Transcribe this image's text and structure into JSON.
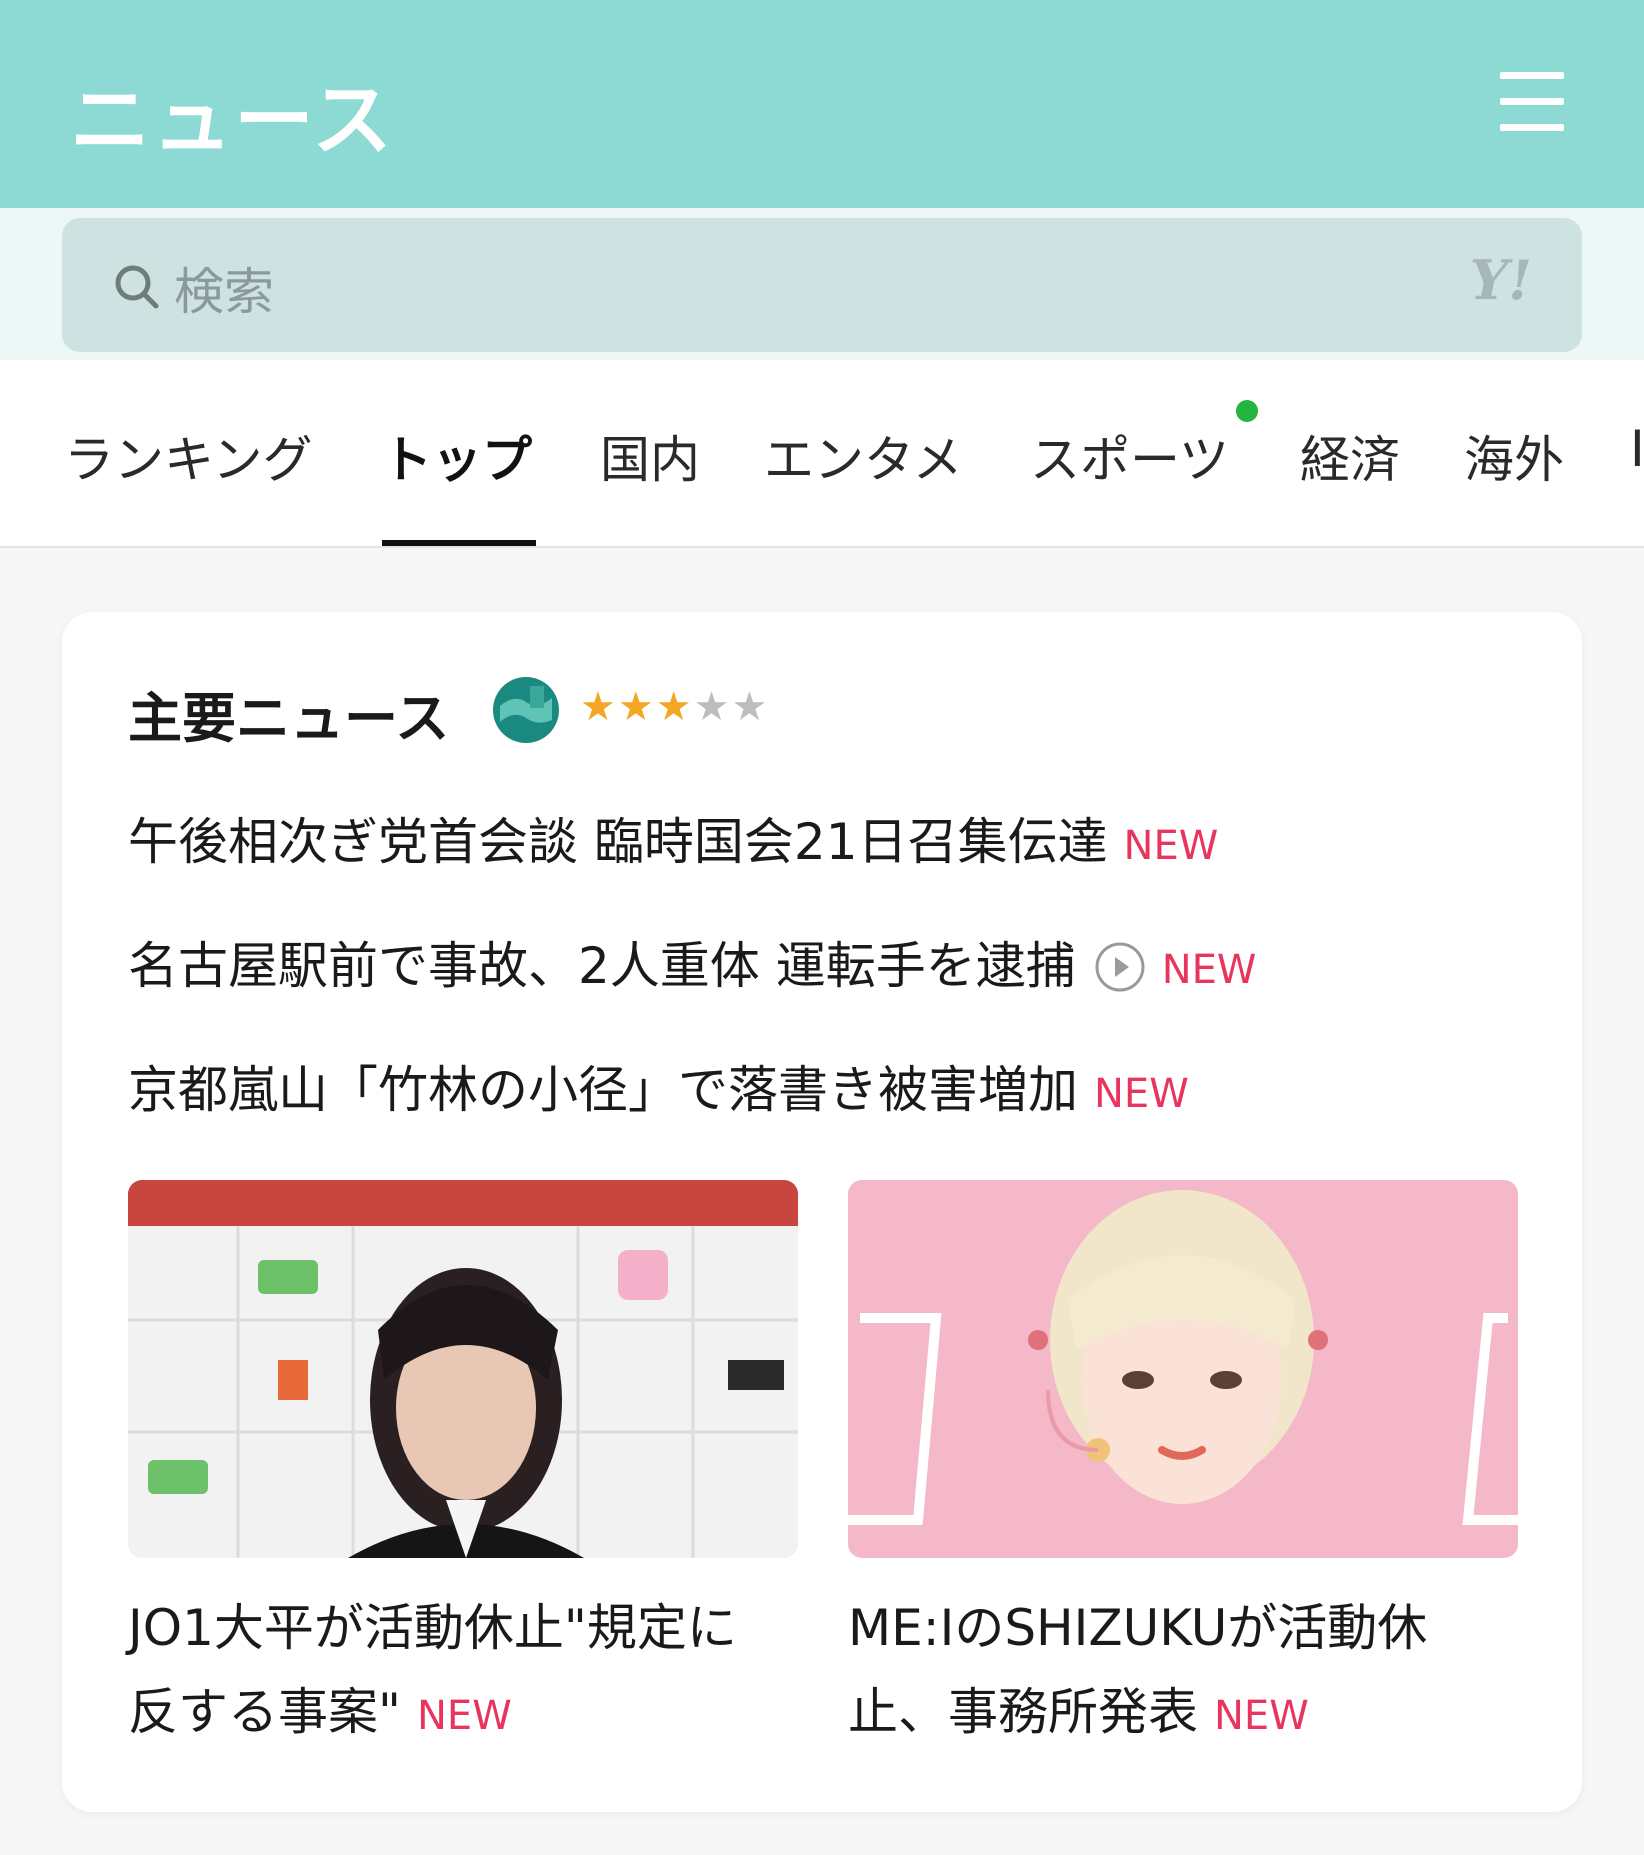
{
  "header": {
    "title": "ニュース",
    "menu_icon": "hamburger-menu-icon"
  },
  "search": {
    "placeholder": "検索",
    "brand": "Y!",
    "icon": "search-icon"
  },
  "tabs": [
    {
      "label": "ランキング",
      "active": false
    },
    {
      "label": "トップ",
      "active": true
    },
    {
      "label": "国内",
      "active": false
    },
    {
      "label": "エンタメ",
      "active": false
    },
    {
      "label": "スポーツ",
      "active": false,
      "indicator": "green-dot"
    },
    {
      "label": "経済",
      "active": false
    },
    {
      "label": "海外",
      "active": false
    },
    {
      "label": "IT",
      "active": false
    }
  ],
  "main_news": {
    "title": "主要ニュース",
    "rating": 3,
    "rating_max": 5,
    "new_badge": "NEW",
    "headlines": [
      {
        "text": "午後相次ぎ党首会談 臨時国会21日召集伝達",
        "video": false
      },
      {
        "text": "名古屋駅前で事故、2人重体 運転手を逮捕",
        "video": true
      },
      {
        "text": "京都嵐山「竹林の小径」で落書き被害増加",
        "video": false
      }
    ],
    "photo_stories": [
      {
        "line1": "JO1大平が活動休止\"規定に",
        "line2": "反する事案\""
      },
      {
        "line1": "ME:IのSHIZUKUが活動休",
        "line2": "止、事務所発表"
      }
    ]
  },
  "colors": {
    "header_bg": "#8ddad4",
    "new_badge": "#e8355d",
    "star": "#f5a623",
    "tab_dot": "#22b53f"
  }
}
